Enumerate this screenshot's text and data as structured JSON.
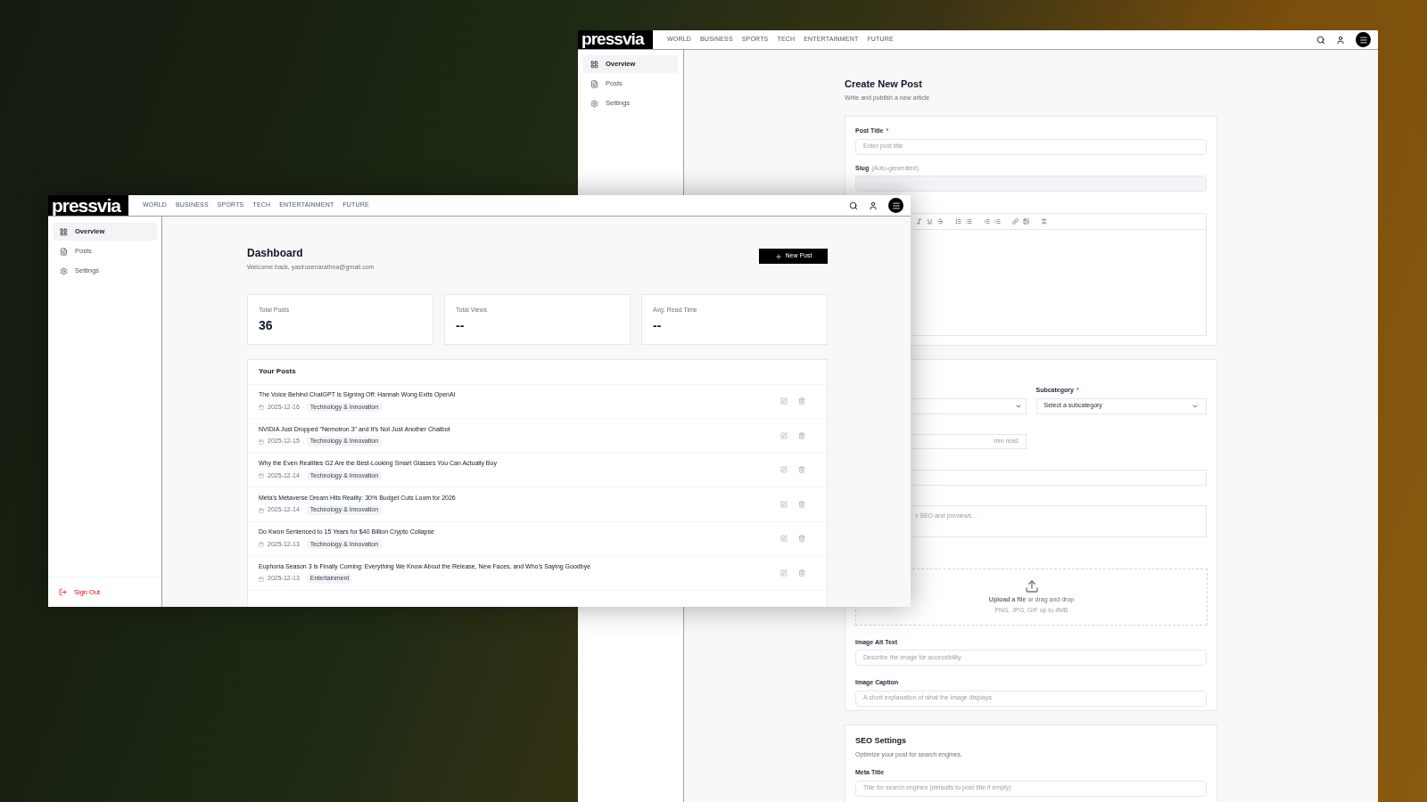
{
  "back_window": {
    "logo": "pressvia",
    "nav": [
      "WORLD",
      "BUSINESS",
      "SPORTS",
      "TECH",
      "ENTERTAINMENT",
      "FUTURE"
    ],
    "sidebar": [
      {
        "label": "Overview",
        "selected": true,
        "kind": "overview"
      },
      {
        "label": "Posts",
        "selected": false,
        "kind": "posts"
      },
      {
        "label": "Settings",
        "selected": false,
        "kind": "settings"
      }
    ],
    "page_title": "Create New Post",
    "page_subtitle": "Write and publish a new article",
    "post_title": {
      "label": "Post Title",
      "required_mark": "*",
      "placeholder": "Enter post title"
    },
    "slug": {
      "label": "Slug",
      "hint": "(Auto-generated)"
    },
    "subcategory": {
      "label": "Subcategory",
      "required_mark": "*",
      "value": "Select a subcategory"
    },
    "read_time": {
      "suffix": "min read"
    },
    "excerpt": {
      "placeholder": "r SEO and previews..."
    },
    "upload": {
      "text": "**Upload a file** or drag and drop",
      "note": "PNG, JPG, GIF up to 4MB"
    },
    "image_alt": {
      "label": "Image Alt Text",
      "placeholder": "Describe the image for accessibility"
    },
    "image_caption": {
      "label": "Image Caption",
      "placeholder": "A short explanation of what the image displays"
    },
    "seo": {
      "title": "SEO Settings",
      "subtitle": "Optimize your post for search engines.",
      "meta_title": {
        "label": "Meta Title",
        "placeholder": "Title for search engines (defaults to post title if empty)"
      }
    }
  },
  "front_window": {
    "logo": "pressvia",
    "nav": [
      "WORLD",
      "BUSINESS",
      "SPORTS",
      "TECH",
      "ENTERTAINMENT",
      "FUTURE"
    ],
    "sidebar": [
      {
        "label": "Overview",
        "selected": true,
        "kind": "overview"
      },
      {
        "label": "Posts",
        "selected": false,
        "kind": "posts"
      },
      {
        "label": "Settings",
        "selected": false,
        "kind": "settings"
      }
    ],
    "sign_out": "Sign Out",
    "page_title": "Dashboard",
    "page_subtitle": "Welcome back, yasirusenarathna@gmail.com",
    "new_post_button": "New Post",
    "stats": [
      {
        "label": "Total Posts",
        "value": "36"
      },
      {
        "label": "Total Views",
        "value": "--"
      },
      {
        "label": "Avg. Read Time",
        "value": "--"
      }
    ],
    "posts_title": "Your Posts",
    "posts": [
      {
        "title": "The Voice Behind ChatGPT is Signing Off: Hannah Wong Exits OpenAI",
        "date": "2025-12-16",
        "category": "Technology & Innovation"
      },
      {
        "title": "NVIDIA Just Dropped \"Nemotron 3\" and It's Not Just Another Chatbot",
        "date": "2025-12-15",
        "category": "Technology & Innovation"
      },
      {
        "title": "Why the Even Realities G2 Are the Best-Looking Smart Glasses You Can Actually Buy",
        "date": "2025-12-14",
        "category": "Technology & Innovation"
      },
      {
        "title": "Meta's Metaverse Dream Hits Reality: 30% Budget Cuts Loom for 2026",
        "date": "2025-12-14",
        "category": "Technology & Innovation"
      },
      {
        "title": "Do Kwon Sentenced to 15 Years for $40 Billion Crypto Collapse",
        "date": "2025-12-13",
        "category": "Technology & Innovation"
      },
      {
        "title": "Euphoria Season 3 is Finally Coming: Everything We Know About the Release, New Faces, and Who's Saying Goodbye",
        "date": "2025-12-13",
        "category": "Entertainment"
      }
    ]
  }
}
